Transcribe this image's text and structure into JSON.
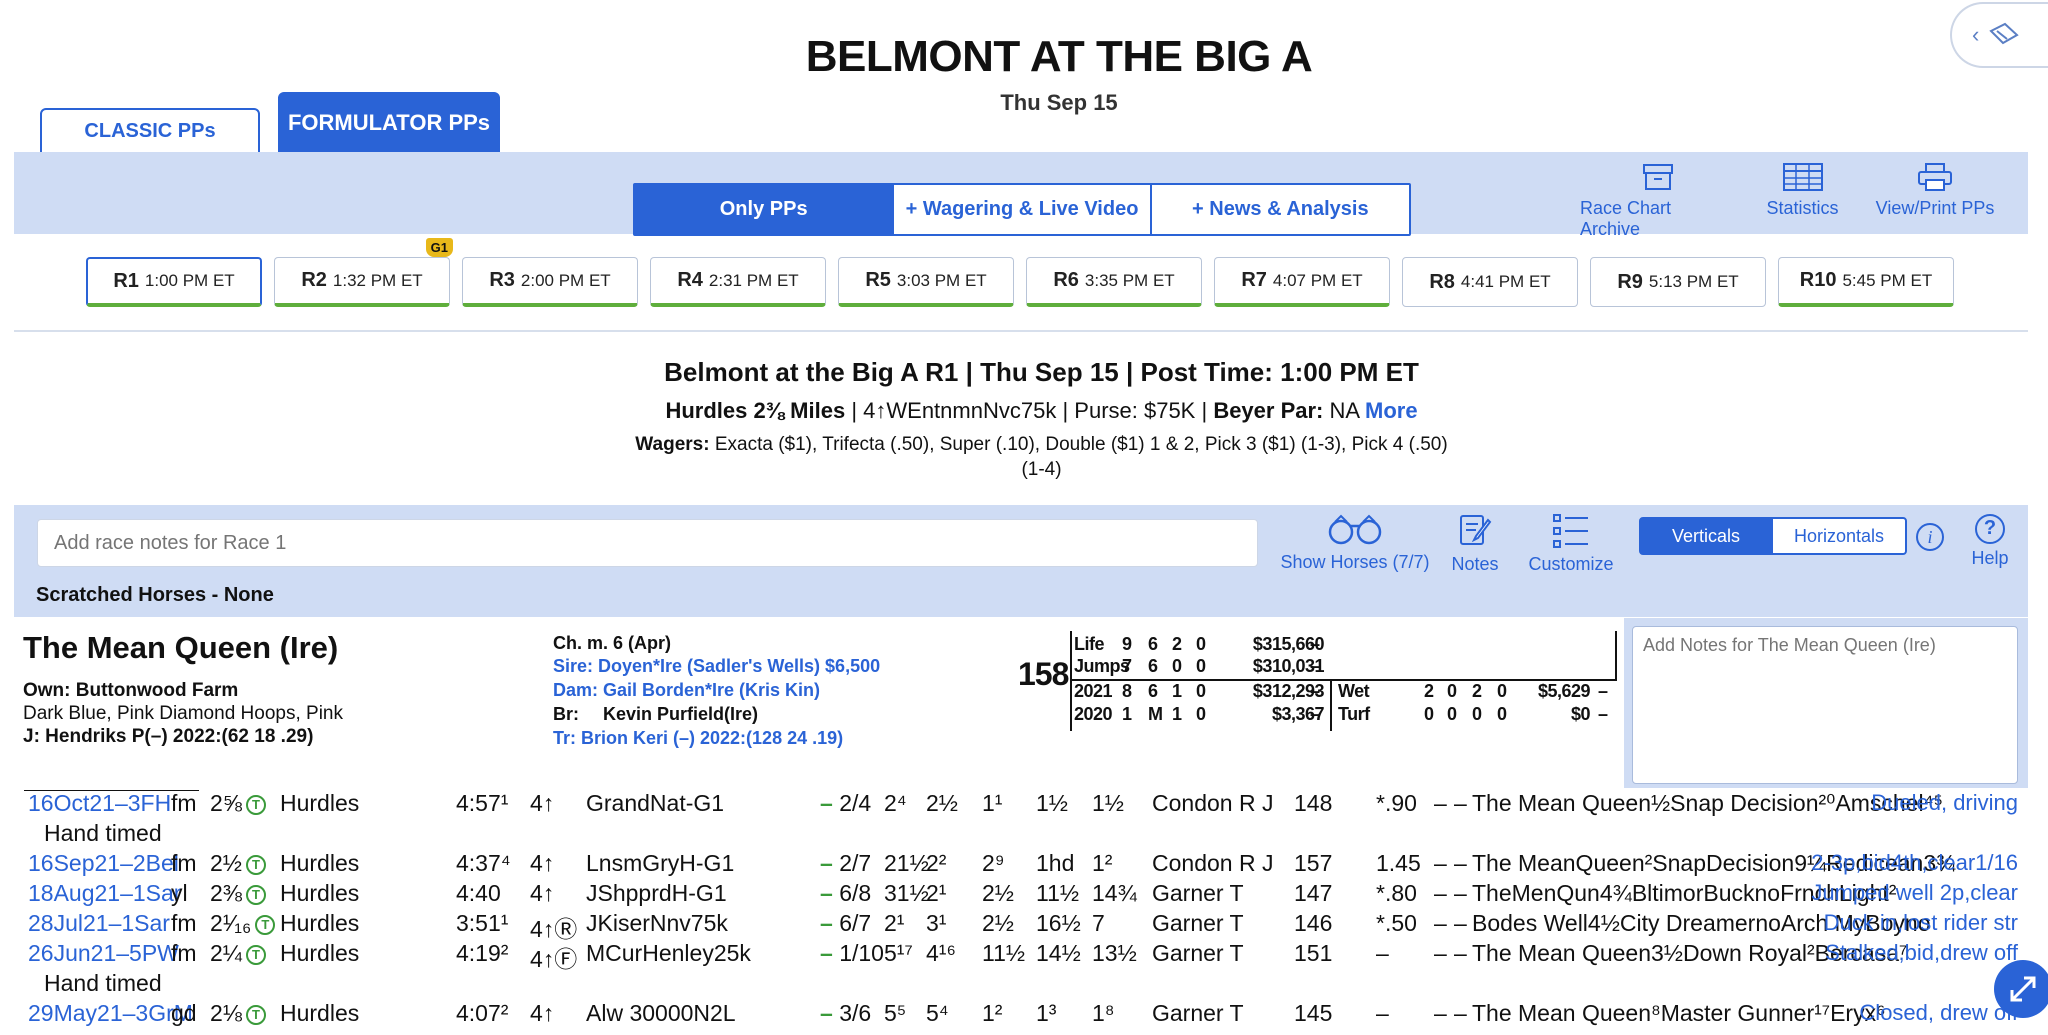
{
  "header": {
    "track_title": "BELMONT AT THE BIG A",
    "date": "Thu Sep 15"
  },
  "tabs": {
    "classic": "CLASSIC PPs",
    "formulator": "FORMULATOR PPs"
  },
  "segment": {
    "only_pps": "Only PPs",
    "wagering": "+ Wagering & Live Video",
    "news": "+ News & Analysis"
  },
  "tools": {
    "race_chart": "Race Chart Archive",
    "statistics": "Statistics",
    "print": "View/Print PPs"
  },
  "races": [
    {
      "num": "R1",
      "time": "1:00 PM ET"
    },
    {
      "num": "R2",
      "time": "1:32 PM ET",
      "badge": "G1"
    },
    {
      "num": "R3",
      "time": "2:00 PM ET"
    },
    {
      "num": "R4",
      "time": "2:31 PM ET"
    },
    {
      "num": "R5",
      "time": "3:03 PM ET"
    },
    {
      "num": "R6",
      "time": "3:35 PM ET"
    },
    {
      "num": "R7",
      "time": "4:07 PM ET"
    },
    {
      "num": "R8",
      "time": "4:41 PM ET"
    },
    {
      "num": "R9",
      "time": "5:13 PM ET"
    },
    {
      "num": "R10",
      "time": "5:45 PM ET"
    }
  ],
  "race_info": {
    "title": "Belmont at the Big A R1 | Thu Sep 15 | Post Time: 1:00 PM ET",
    "dist_label": "Hurdles 2⅜ Miles",
    "cond": "4↑WEntnmnNvc75k",
    "purse": "Purse: $75K",
    "beyer_label": "Beyer Par:",
    "beyer_value": "NA",
    "more": "More",
    "wagers_label": "Wagers:",
    "wagers_text": "Exacta ($1), Trifecta (.50), Super (.10), Double ($1) 1 & 2, Pick 3 ($1) (1-3), Pick 4 (.50)",
    "wagers_text2": "(1-4)"
  },
  "notes_bar": {
    "placeholder": "Add race notes for Race 1",
    "show_horses": "Show Horses (7/7)",
    "notes": "Notes",
    "customize": "Customize",
    "verticals": "Verticals",
    "horizontals": "Horizontals",
    "help": "Help",
    "scratched": "Scratched Horses - None"
  },
  "horse": {
    "name": "The Mean Queen (Ire)",
    "owner": "Own: Buttonwood Farm",
    "silks": "Dark Blue, Pink Diamond Hoops, Pink",
    "jockey": "J: Hendriks P(–) 2022:(62 18 .29)",
    "desc": "Ch. m. 6 (Apr)",
    "sire": "Sire:  Doyen*Ire (Sadler's Wells) $6,500",
    "dam": "Dam:  Gail Borden*Ire (Kris Kin)",
    "breeder_label": "Br:",
    "breeder": "Kevin Purfield(Ire)",
    "trainer": "Tr:    Brion Keri (–) 2022:(128 24 .19)",
    "rating": "158",
    "notes_placeholder": "Add Notes for The Mean Queen (Ire)",
    "stats": [
      [
        "Life",
        "9",
        "6",
        "2",
        "0",
        "$315,660",
        "–"
      ],
      [
        "Jumps",
        "7",
        "6",
        "0",
        "0",
        "$310,031",
        "–"
      ],
      [
        "2021",
        "8",
        "6",
        "1",
        "0",
        "$312,293",
        "–"
      ],
      [
        "2020",
        "1",
        "M",
        "1",
        "0",
        "$3,367",
        "–"
      ]
    ],
    "surface_stats": [
      [
        "Wet",
        "2",
        "0",
        "2",
        "0",
        "$5,629",
        "–"
      ],
      [
        "Turf",
        "0",
        "0",
        "0",
        "0",
        "$0",
        "–"
      ]
    ]
  },
  "pps": [
    {
      "date": "16Oct21–3FH",
      "cond": "fm",
      "dist": "2⅝",
      "type": "Hurdles",
      "time": "4:57¹",
      "age": "4↑",
      "race": "GrandNat-G1",
      "odds_post": "2/4",
      "c1": "2⁴",
      "c2": "2½",
      "c3": "1¹",
      "c4": "1½",
      "fin": "1½",
      "jockey": "Condon R J",
      "wt": "148",
      "odds": "*.90",
      "x1": "–",
      "x2": "–",
      "comp": "The Mean Queen½Snap Decision²⁰Amschel⁴⁵",
      "comment": "Dueled, driving",
      "note": "Hand timed"
    },
    {
      "date": "16Sep21–2Bel",
      "cond": "fm",
      "dist": "2½",
      "type": "Hurdles",
      "time": "4:37⁴",
      "age": "4↑",
      "race": "LnsmGryH-G1",
      "odds_post": "2/7",
      "c1": "21½",
      "c2": "2²",
      "c3": "2⁹",
      "c4": "1hd",
      "fin": "1²",
      "jockey": "Condon R J",
      "wt": "157",
      "odds": "1.45",
      "x1": "–",
      "x2": "–",
      "comp": "The MeanQueen²SnapDecision9¼Redicean3¾",
      "comment": "2-3p,bid4th,clear1/16"
    },
    {
      "date": "18Aug21–1Sar",
      "cond": "yl",
      "dist": "2⅜",
      "type": "Hurdles",
      "time": "4:40",
      "age": "4↑",
      "race": "JShpprdH-G1",
      "odds_post": "6/8",
      "c1": "31½",
      "c2": "2¹",
      "c3": "2½",
      "c4": "11½",
      "fin": "14¾",
      "jockey": "Garner T",
      "wt": "147",
      "odds": "*.80",
      "x1": "–",
      "x2": "–",
      "comp": "TheMenQun4¾BltimorBucknoFrnchLight²",
      "comment": "Jumped well 2p,clear"
    },
    {
      "date": "28Jul21–1Sar",
      "cond": "fm",
      "dist": "2¹⁄₁₆",
      "type": "Hurdles",
      "time": "3:51¹",
      "age": "4↑Ⓡ",
      "race": "JKiserNnv75k",
      "odds_post": "6/7",
      "c1": "2¹",
      "c2": "3¹",
      "c3": "2½",
      "c4": "16½",
      "fin": "7",
      "jockey": "Garner T",
      "wt": "146",
      "odds": "*.50",
      "x1": "–",
      "x2": "–",
      "comp": "Bodes Well4½City DreamernoArch MyBoyno",
      "comment": "Duck in,lost rider str"
    },
    {
      "date": "26Jun21–5PW",
      "cond": "fm",
      "dist": "2¼",
      "type": "Hurdles",
      "time": "4:19²",
      "age": "4↑Ⓕ",
      "race": "MCurHenley25k",
      "odds_post": "1/10",
      "c1": "5¹⁷",
      "c2": "4¹⁶",
      "c3": "11½",
      "c4": "14½",
      "fin": "13½",
      "jockey": "Garner T",
      "wt": "151",
      "odds": "–",
      "x1": "–",
      "x2": "–",
      "comp": "The Mean Queen3½Down Royal²Bercasa⁷",
      "comment": "Stalked,bid,drew off",
      "note": "Hand timed"
    },
    {
      "date": "29May21–3GrM",
      "cond": "gd",
      "dist": "2⅛",
      "type": "Hurdles",
      "time": "4:07²",
      "age": "4↑",
      "race": "Alw 30000N2L",
      "odds_post": "3/6",
      "c1": "5⁵",
      "c2": "5⁴",
      "c3": "1²",
      "c4": "1³",
      "fin": "1⁸",
      "jockey": "Garner T",
      "wt": "145",
      "odds": "–",
      "x1": "–",
      "x2": "–",
      "comp": "The Mean Queen⁸Master Gunner¹⁷Eryx⁶",
      "comment": "Closed, drew off"
    }
  ]
}
